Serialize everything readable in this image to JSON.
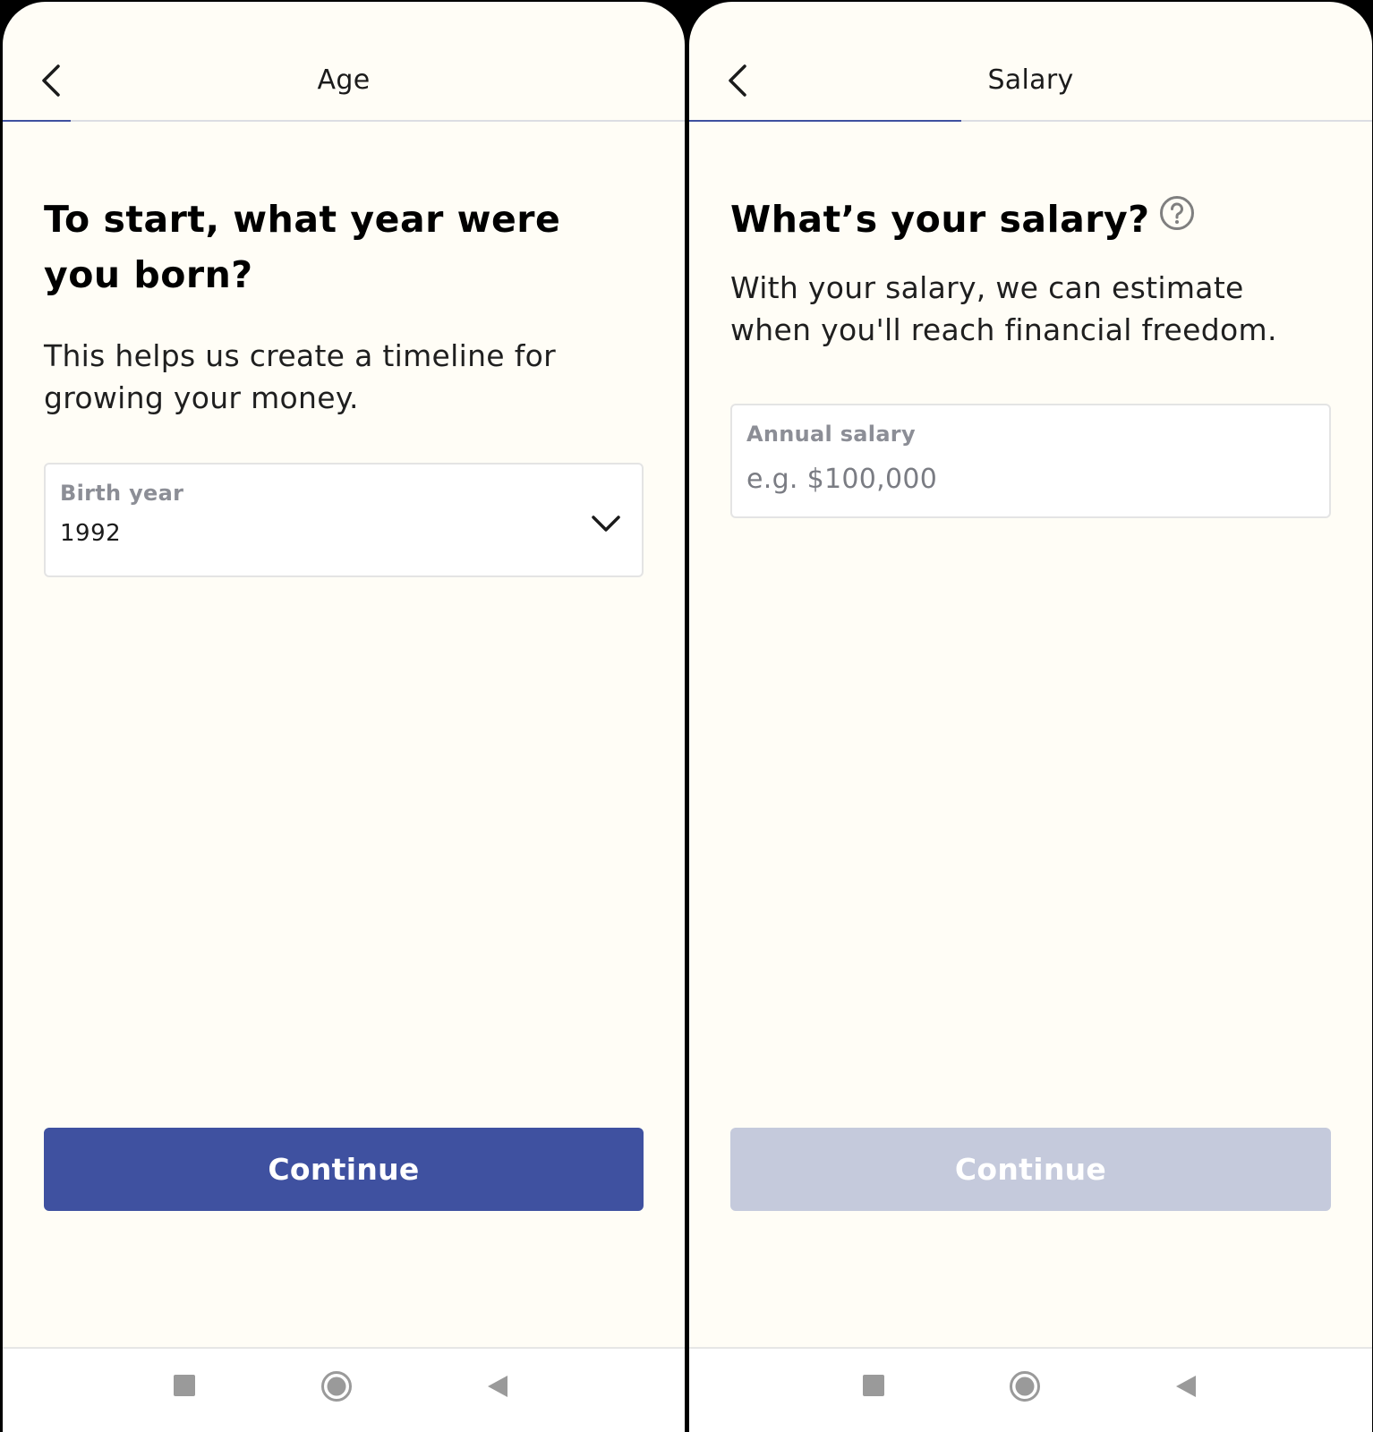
{
  "screens": [
    {
      "id": "age",
      "topbar": {
        "back_icon": "chevron-left-icon",
        "title": "Age"
      },
      "progress": 0.1,
      "heading": "To start, what year were you born?",
      "subtitle": "This helps us create a timeline for growing your money.",
      "field": {
        "type": "select",
        "label": "Birth year",
        "value": "1992",
        "icon": "chevron-down-icon"
      },
      "continue_button": {
        "label": "Continue",
        "state": "enabled"
      }
    },
    {
      "id": "salary",
      "topbar": {
        "back_icon": "chevron-left-icon",
        "title": "Salary"
      },
      "progress": 0.4,
      "heading": "What’s your salary?",
      "help_icon": "question-circle-icon",
      "subtitle": "With your salary, we can estimate when you'll reach financial freedom.",
      "field": {
        "type": "input",
        "label": "Annual salary",
        "value": "",
        "placeholder": "e.g. $100,000"
      },
      "continue_button": {
        "label": "Continue",
        "state": "disabled"
      }
    }
  ],
  "navbar": {
    "buttons": [
      "recents-square-icon",
      "home-circle-icon",
      "back-triangle-icon"
    ]
  },
  "colors": {
    "background": "#fffdf6",
    "accent": "#3f51a0",
    "disabled_button": "#c5cadc",
    "progress_track": "#dcdde3"
  }
}
